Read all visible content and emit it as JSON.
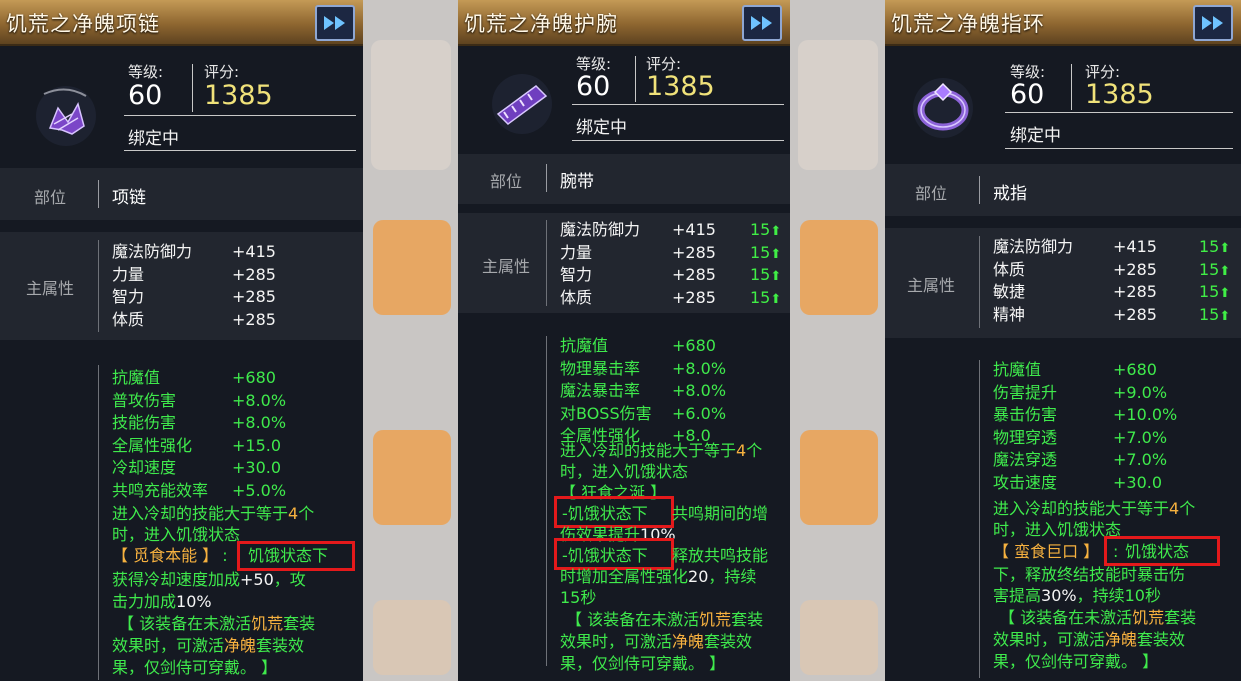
{
  "cards": [
    {
      "title": "饥荒之净魄项链",
      "level_label": "等级:",
      "level": "60",
      "score_label": "评分:",
      "score": "1385",
      "bound": "绑定中",
      "slot_label": "部位",
      "slot": "项链",
      "main_label": "主属性",
      "main_attrs": [
        {
          "name": "魔法防御力",
          "value": "+415"
        },
        {
          "name": "力量",
          "value": "+285"
        },
        {
          "name": "智力",
          "value": "+285"
        },
        {
          "name": "体质",
          "value": "+285"
        }
      ],
      "extra_attrs": [
        {
          "name": "抗魔值",
          "value": "+680"
        },
        {
          "name": "普攻伤害",
          "value": "+8.0%"
        },
        {
          "name": "技能伤害",
          "value": "+8.0%"
        },
        {
          "name": "全属性强化",
          "value": "+15.0"
        },
        {
          "name": "冷却速度",
          "value": "+30.0"
        },
        {
          "name": "共鸣充能效率",
          "value": "+5.0%"
        }
      ],
      "effect_l1a": "进入冷却的技能大于等于",
      "effect_l1b": "4",
      "effect_l1c": "个",
      "effect_l2": "时，进入饥饿状态",
      "effect_tag": "【 觅食本能 】",
      "effect_colon": ":",
      "effect_hl": "饥饿状态下",
      "effect_l4a": "获得冷却速度加成",
      "effect_l4b": "+50",
      "effect_l4c": "，攻",
      "effect_l5a": "击力加成",
      "effect_l5b": "10%",
      "set_l1a": "【 该装备在未激活",
      "set_l1b": "饥荒",
      "set_l1c": "套装",
      "set_l2a": "效果时，可激活",
      "set_l2b": "净魄",
      "set_l2c": "套装效",
      "set_l3": "果，仅剑侍可穿戴。 】"
    },
    {
      "title": "饥荒之净魄护腕",
      "level_label": "等级:",
      "level": "60",
      "score_label": "评分:",
      "score": "1385",
      "bound": "绑定中",
      "slot_label": "部位",
      "slot": "腕带",
      "main_label": "主属性",
      "main_attrs": [
        {
          "name": "魔法防御力",
          "value": "+415",
          "up": "15"
        },
        {
          "name": "力量",
          "value": "+285",
          "up": "15"
        },
        {
          "name": "智力",
          "value": "+285",
          "up": "15"
        },
        {
          "name": "体质",
          "value": "+285",
          "up": "15"
        }
      ],
      "extra_attrs": [
        {
          "name": "抗魔值",
          "value": "+680"
        },
        {
          "name": "物理暴击率",
          "value": "+8.0%"
        },
        {
          "name": "魔法暴击率",
          "value": "+8.0%"
        },
        {
          "name": "对BOSS伤害",
          "value": "+6.0%"
        },
        {
          "name": "全属性强化",
          "value": "+8.0"
        }
      ],
      "effect_l1a": "进入冷却的技能大于等于",
      "effect_l1b": "4",
      "effect_l1c": "个",
      "effect_l2": "时，进入饥饿状态",
      "effect_tag": "【 狂食之涎 】",
      "effect_hl1": "-饥饿状态下",
      "effect_l4": "共鸣期间的增",
      "effect_l5a": "伤效果提升",
      "effect_l5b": "10%",
      "effect_hl2": "-饥饿状态下",
      "effect_l6": "释放共鸣技能",
      "effect_l7a": "时增加全属性强化",
      "effect_l7b": "20",
      "effect_l7c": "，持续",
      "effect_l8": "15秒",
      "set_l1a": "【 该装备在未激活",
      "set_l1b": "饥荒",
      "set_l1c": "套装",
      "set_l2a": "效果时，可激活",
      "set_l2b": "净魄",
      "set_l2c": "套装效",
      "set_l3": "果，仅剑侍可穿戴。 】"
    },
    {
      "title": "饥荒之净魄指环",
      "level_label": "等级:",
      "level": "60",
      "score_label": "评分:",
      "score": "1385",
      "bound": "绑定中",
      "slot_label": "部位",
      "slot": "戒指",
      "main_label": "主属性",
      "main_attrs": [
        {
          "name": "魔法防御力",
          "value": "+415",
          "up": "15"
        },
        {
          "name": "体质",
          "value": "+285",
          "up": "15"
        },
        {
          "name": "敏捷",
          "value": "+285",
          "up": "15"
        },
        {
          "name": "精神",
          "value": "+285",
          "up": "15"
        }
      ],
      "extra_attrs": [
        {
          "name": "抗魔值",
          "value": "+680"
        },
        {
          "name": "伤害提升",
          "value": "+9.0%"
        },
        {
          "name": "暴击伤害",
          "value": "+10.0%"
        },
        {
          "name": "物理穿透",
          "value": "+7.0%"
        },
        {
          "name": "魔法穿透",
          "value": "+7.0%"
        },
        {
          "name": "攻击速度",
          "value": "+30.0"
        }
      ],
      "effect_l1a": "进入冷却的技能大于等于",
      "effect_l1b": "4",
      "effect_l1c": "个",
      "effect_l2": "时，进入饥饿状态",
      "effect_tag": "【 蛮食巨口 】",
      "effect_colon": ":",
      "effect_hl": "饥饿状态",
      "effect_l4": "下，释放终结技能时暴击伤",
      "effect_l5a": "害提高",
      "effect_l5b": "30%",
      "effect_l5c": "，持续",
      "effect_l5d": "10秒",
      "set_l1a": "【 该装备在未激活",
      "set_l1b": "饥荒",
      "set_l1c": "套装",
      "set_l2a": "效果时，可激活",
      "set_l2b": "净魄",
      "set_l2c": "套装效",
      "set_l3": "果，仅剑侍可穿戴。 】"
    }
  ],
  "icons": {
    "expand": "fast-forward-icon",
    "up": "arrow-up-icon"
  },
  "colors": {
    "green_text": "#3fea4c",
    "orange_text": "#f6b13f",
    "score": "#f0e27a",
    "highlight_box": "#e4191b"
  }
}
